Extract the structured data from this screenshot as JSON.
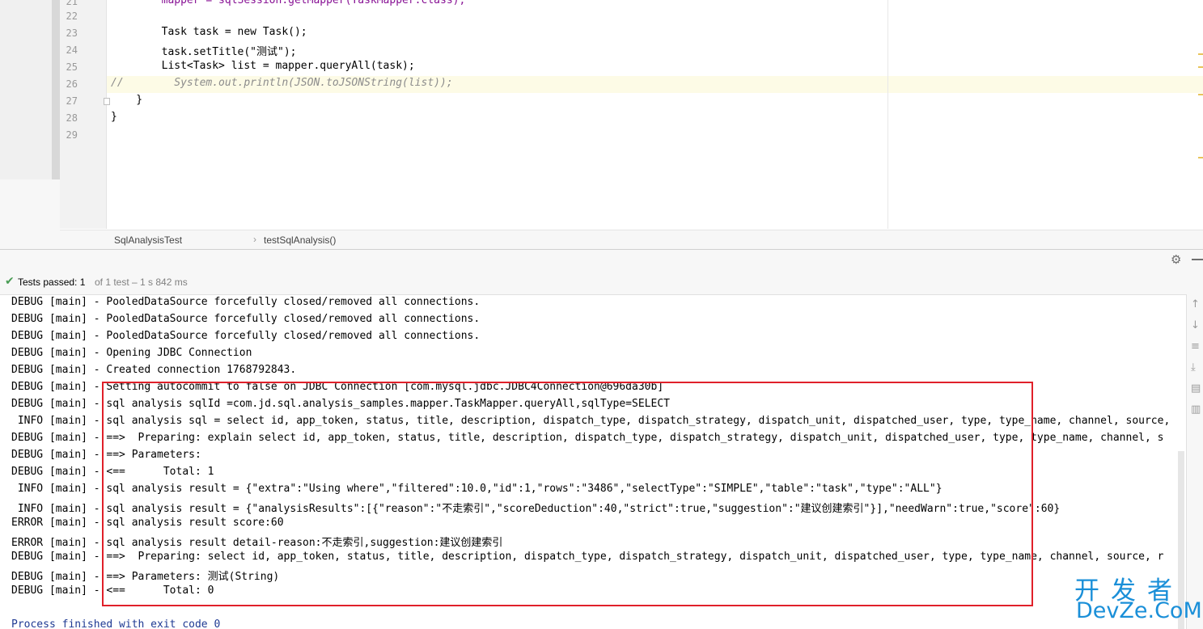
{
  "editor": {
    "lines": [
      {
        "num": "21",
        "code": "        mapper = sqlSession.getMapper(TaskMapper.class);"
      },
      {
        "num": "22",
        "code": ""
      },
      {
        "num": "23",
        "code": "        Task task = new Task();"
      },
      {
        "num": "24",
        "code": "        task.setTitle(\"测试\");"
      },
      {
        "num": "25",
        "code": "        List<Task> list = mapper.queryAll(task);"
      },
      {
        "num": "26",
        "code": "//        System.out.println(JSON.toJSONString(list));"
      },
      {
        "num": "27",
        "code": "    }"
      },
      {
        "num": "28",
        "code": "}"
      },
      {
        "num": "29",
        "code": ""
      }
    ]
  },
  "breadcrumb": {
    "class_name": "SqlAnalysisTest",
    "separator": "›",
    "method_name": "testSqlAnalysis()"
  },
  "run_panel": {
    "status_main": "Tests passed: 1",
    "status_sub": "of 1 test – 1 s 842 ms",
    "gear_icon": "⚙",
    "check_icon": "✔"
  },
  "console": {
    "lines": [
      "DEBUG [main] - PooledDataSource forcefully closed/removed all connections.",
      "DEBUG [main] - PooledDataSource forcefully closed/removed all connections.",
      "DEBUG [main] - PooledDataSource forcefully closed/removed all connections.",
      "DEBUG [main] - Opening JDBC Connection",
      "DEBUG [main] - Created connection 1768792843.",
      "DEBUG [main] - Setting autocommit to false on JDBC Connection [com.mysql.jdbc.JDBC4Connection@696da30b]",
      "DEBUG [main] - sql analysis sqlId =com.jd.sql.analysis_samples.mapper.TaskMapper.queryAll,sqlType=SELECT",
      " INFO [main] - sql analysis sql = select id, app_token, status, title, description, dispatch_type, dispatch_strategy, dispatch_unit, dispatched_user, type, type_name, channel, source,",
      "DEBUG [main] - ==>  Preparing: explain select id, app_token, status, title, description, dispatch_type, dispatch_strategy, dispatch_unit, dispatched_user, type, type_name, channel, s",
      "DEBUG [main] - ==> Parameters: ",
      "DEBUG [main] - <==      Total: 1",
      " INFO [main] - sql analysis result = {\"extra\":\"Using where\",\"filtered\":10.0,\"id\":1,\"rows\":\"3486\",\"selectType\":\"SIMPLE\",\"table\":\"task\",\"type\":\"ALL\"}",
      " INFO [main] - sql analysis result = {\"analysisResults\":[{\"reason\":\"不走索引\",\"scoreDeduction\":40,\"strict\":true,\"suggestion\":\"建议创建索引\"}],\"needWarn\":true,\"score\":60}",
      "ERROR [main] - sql analysis result score:60",
      "ERROR [main] - sql analysis result detail-reason:不走索引,suggestion:建议创建索引",
      "DEBUG [main] - ==>  Preparing: select id, app_token, status, title, description, dispatch_type, dispatch_strategy, dispatch_unit, dispatched_user, type, type_name, channel, source, r",
      "DEBUG [main] - ==> Parameters: 测试(String)",
      "DEBUG [main] - <==      Total: 0"
    ],
    "exit_line": "Process finished with exit code 0"
  },
  "watermark": {
    "top": "开发者",
    "bottom": "DevZe.CoM"
  }
}
